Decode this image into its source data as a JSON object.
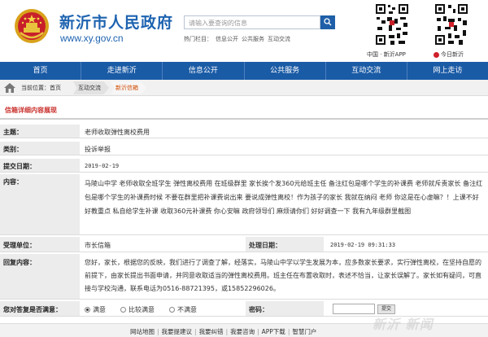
{
  "header": {
    "site_title": "新沂市人民政府",
    "site_url": "www.xy.gov.cn",
    "search_placeholder": "请输入要查询的信息",
    "hot_search_label": "热门栏目：",
    "hot_search_items": [
      "信息公开",
      "公共服务",
      "互动交流"
    ],
    "qr_labels": [
      "中国 · 新沂APP",
      "今日新沂"
    ]
  },
  "nav": {
    "items": [
      "首页",
      "走进新沂",
      "信息公开",
      "公共服务",
      "互动交流",
      "网上走访"
    ]
  },
  "breadcrumb": {
    "label": "当前位置：首页",
    "items": [
      "互动交流",
      "新沂信箱"
    ]
  },
  "section_title": "信箱详细内容展现",
  "detail": {
    "subject_label": "主题：",
    "subject": "老师收取弹性离校费用",
    "category_label": "类别：",
    "category": "投诉举报",
    "date_label": "提交日期：",
    "date": "2019-02-19",
    "content_label": "内容：",
    "content": "马陵山中学 老师收取全班学生 弹性离校费用 在班级群里 家长挨个发360元给班主任 备注红包是哪个学生的补课费 老师就斥责家长 备注红包是哪个学生的补课费时候 不要在群里把补课费说出来 要说成弹性离校！作为孩子的家长 我就在纳闷 老师 你这是在心虚嘛？！上课不好好教重点 私自给学生补课 收取360元补课费 你心安嘛 政府领导们 麻烦请你们 好好调查一下 我有九年级群里截图",
    "dept_label": "受理单位：",
    "dept": "市长信箱",
    "process_date_label": "处理日期：",
    "process_date": "2019-02-19 09:31:33",
    "reply_label": "回复内容：",
    "reply": "您好，家长，根据您的反映，我们进行了调查了解，经落实，马陵山中学以学生发展为本，应多数家长要求，实行弹性离校，在坚持自愿的前提下，由家长提出书面申请，并同意收取适当的弹性离校费用。班主任在布置收取时，表述不恰当，让家长误解了。家长如有疑问，可直接与学校沟通，联系电话为0516-88721395，或15852296026。",
    "satisfaction_label": "您对答复是否满意：",
    "satisfaction_options": [
      "满意",
      "比较满意",
      "不满意"
    ],
    "satisfaction_selected": "满意",
    "password_label": "密码：",
    "submit_label": "提交"
  },
  "footer": {
    "links": [
      "网站地图",
      "我要提建议",
      "我要纠错",
      "我要咨询",
      "APP下载",
      "智慧门户"
    ],
    "watermark": "新沂 新闻"
  },
  "colors": {
    "brand_blue": "#1a5ba6",
    "title_red": "#c8302c",
    "active_orange": "#d14a00"
  }
}
